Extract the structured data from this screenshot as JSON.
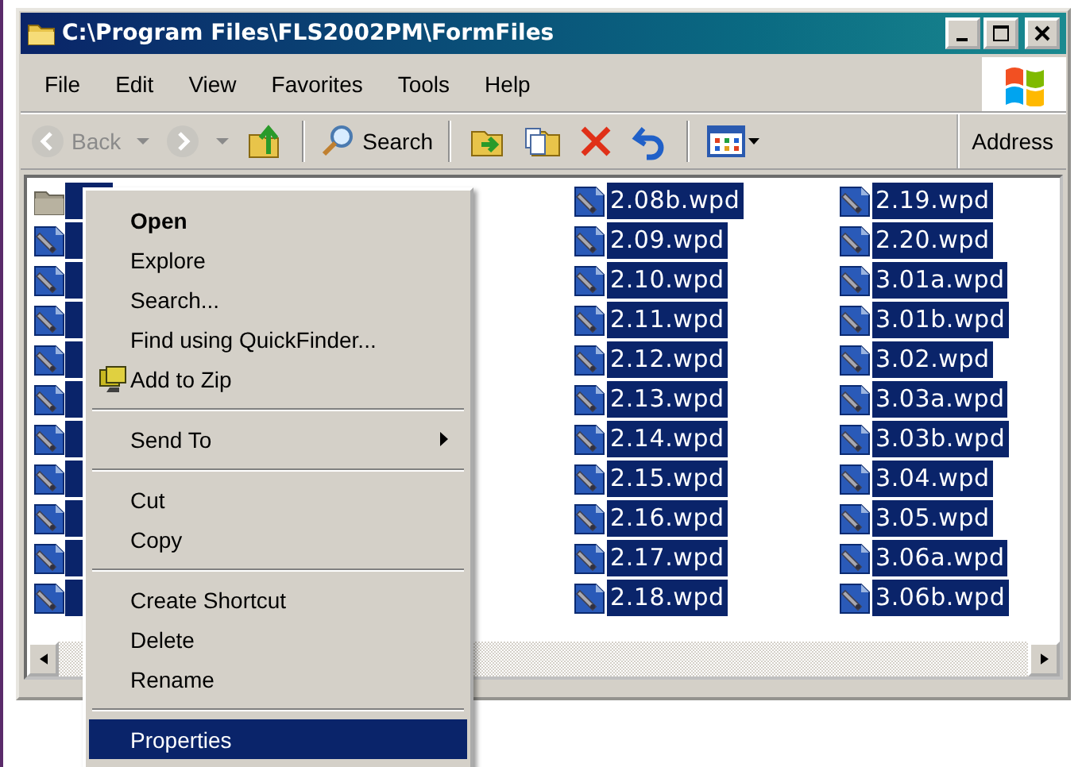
{
  "window": {
    "title": "C:\\Program Files\\FLS2002PM\\FormFiles"
  },
  "menu_bar": [
    "File",
    "Edit",
    "View",
    "Favorites",
    "Tools",
    "Help"
  ],
  "toolbar": {
    "back": {
      "label": "Back",
      "disabled": true
    },
    "forward": {
      "disabled": true
    },
    "search": {
      "label": "Search"
    },
    "address": {
      "label": "Address"
    }
  },
  "files": {
    "columns": [
      {
        "items": [
          {
            "kind": "folder",
            "selected": true
          },
          {
            "kind": "file",
            "selected": true
          },
          {
            "kind": "file",
            "selected": true
          },
          {
            "kind": "file",
            "selected": true
          },
          {
            "kind": "file",
            "selected": true
          },
          {
            "kind": "file",
            "selected": true
          },
          {
            "kind": "file",
            "selected": true
          },
          {
            "kind": "file",
            "selected": true
          },
          {
            "kind": "file",
            "selected": true
          },
          {
            "kind": "file",
            "selected": true
          },
          {
            "kind": "file",
            "selected": true
          }
        ]
      },
      {
        "items": [
          {
            "kind": "file",
            "name": "2.08b.wpd",
            "selected": true
          },
          {
            "kind": "file",
            "name": "2.09.wpd",
            "selected": true
          },
          {
            "kind": "file",
            "name": "2.10.wpd",
            "selected": true
          },
          {
            "kind": "file",
            "name": "2.11.wpd",
            "selected": true
          },
          {
            "kind": "file",
            "name": "2.12.wpd",
            "selected": true
          },
          {
            "kind": "file",
            "name": "2.13.wpd",
            "selected": true
          },
          {
            "kind": "file",
            "name": "2.14.wpd",
            "selected": true
          },
          {
            "kind": "file",
            "name": "2.15.wpd",
            "selected": true
          },
          {
            "kind": "file",
            "name": "2.16.wpd",
            "selected": true
          },
          {
            "kind": "file",
            "name": "2.17.wpd",
            "selected": true
          },
          {
            "kind": "file",
            "name": "2.18.wpd",
            "selected": true
          }
        ]
      },
      {
        "items": [
          {
            "kind": "file",
            "name": "2.19.wpd",
            "selected": true
          },
          {
            "kind": "file",
            "name": "2.20.wpd",
            "selected": true
          },
          {
            "kind": "file",
            "name": "3.01a.wpd",
            "selected": true
          },
          {
            "kind": "file",
            "name": "3.01b.wpd",
            "selected": true
          },
          {
            "kind": "file",
            "name": "3.02.wpd",
            "selected": true
          },
          {
            "kind": "file",
            "name": "3.03a.wpd",
            "selected": true
          },
          {
            "kind": "file",
            "name": "3.03b.wpd",
            "selected": true
          },
          {
            "kind": "file",
            "name": "3.04.wpd",
            "selected": true
          },
          {
            "kind": "file",
            "name": "3.05.wpd",
            "selected": true
          },
          {
            "kind": "file",
            "name": "3.06a.wpd",
            "selected": true
          },
          {
            "kind": "file",
            "name": "3.06b.wpd",
            "selected": true
          }
        ]
      }
    ]
  },
  "context_menu": {
    "items": [
      {
        "kind": "item",
        "label": "Open",
        "default": true,
        "selected": false
      },
      {
        "kind": "item",
        "label": "Explore",
        "default": false,
        "selected": false
      },
      {
        "kind": "item",
        "label": "Search...",
        "default": false,
        "selected": false
      },
      {
        "kind": "item",
        "label": "Find using QuickFinder...",
        "default": false,
        "selected": false
      },
      {
        "kind": "icon_item",
        "label": "Add to Zip",
        "default": false,
        "selected": false
      },
      {
        "kind": "separator"
      },
      {
        "kind": "submenu",
        "label": "Send To",
        "default": false,
        "selected": false
      },
      {
        "kind": "separator"
      },
      {
        "kind": "item",
        "label": "Cut",
        "default": false,
        "selected": false
      },
      {
        "kind": "item",
        "label": "Copy",
        "default": false,
        "selected": false
      },
      {
        "kind": "separator"
      },
      {
        "kind": "item",
        "label": "Create Shortcut",
        "default": false,
        "selected": false
      },
      {
        "kind": "item",
        "label": "Delete",
        "default": false,
        "selected": false
      },
      {
        "kind": "item",
        "label": "Rename",
        "default": false,
        "selected": false
      },
      {
        "kind": "separator"
      },
      {
        "kind": "item",
        "label": "Properties",
        "default": false,
        "selected": true
      }
    ]
  }
}
